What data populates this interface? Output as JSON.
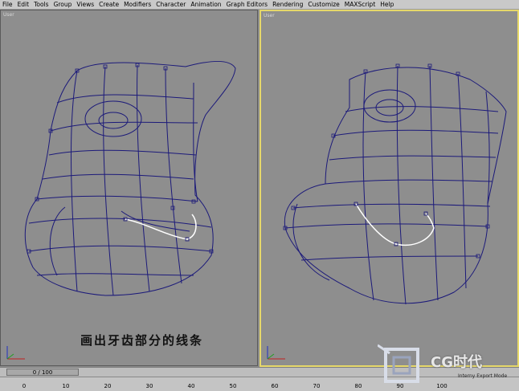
{
  "menu": {
    "items": [
      "File",
      "Edit",
      "Tools",
      "Group",
      "Views",
      "Create",
      "Modifiers",
      "Character",
      "Animation",
      "Graph Editors",
      "Rendering",
      "Customize",
      "MAXScript",
      "Help"
    ]
  },
  "viewports": {
    "left_label": "User",
    "right_label": "User"
  },
  "caption": "画出牙齿部分的线条",
  "timeline": {
    "slider_text": "0 / 100",
    "ticks": [
      "0",
      "10",
      "20",
      "30",
      "40",
      "50",
      "60",
      "70",
      "80",
      "90",
      "100"
    ]
  },
  "logo": {
    "text": "CG时代",
    "subtext": "Interny Export Mode"
  },
  "colors": {
    "wire": "#1c1a7a",
    "selected_line": "#ffffff",
    "active_border": "#e6d86a"
  }
}
